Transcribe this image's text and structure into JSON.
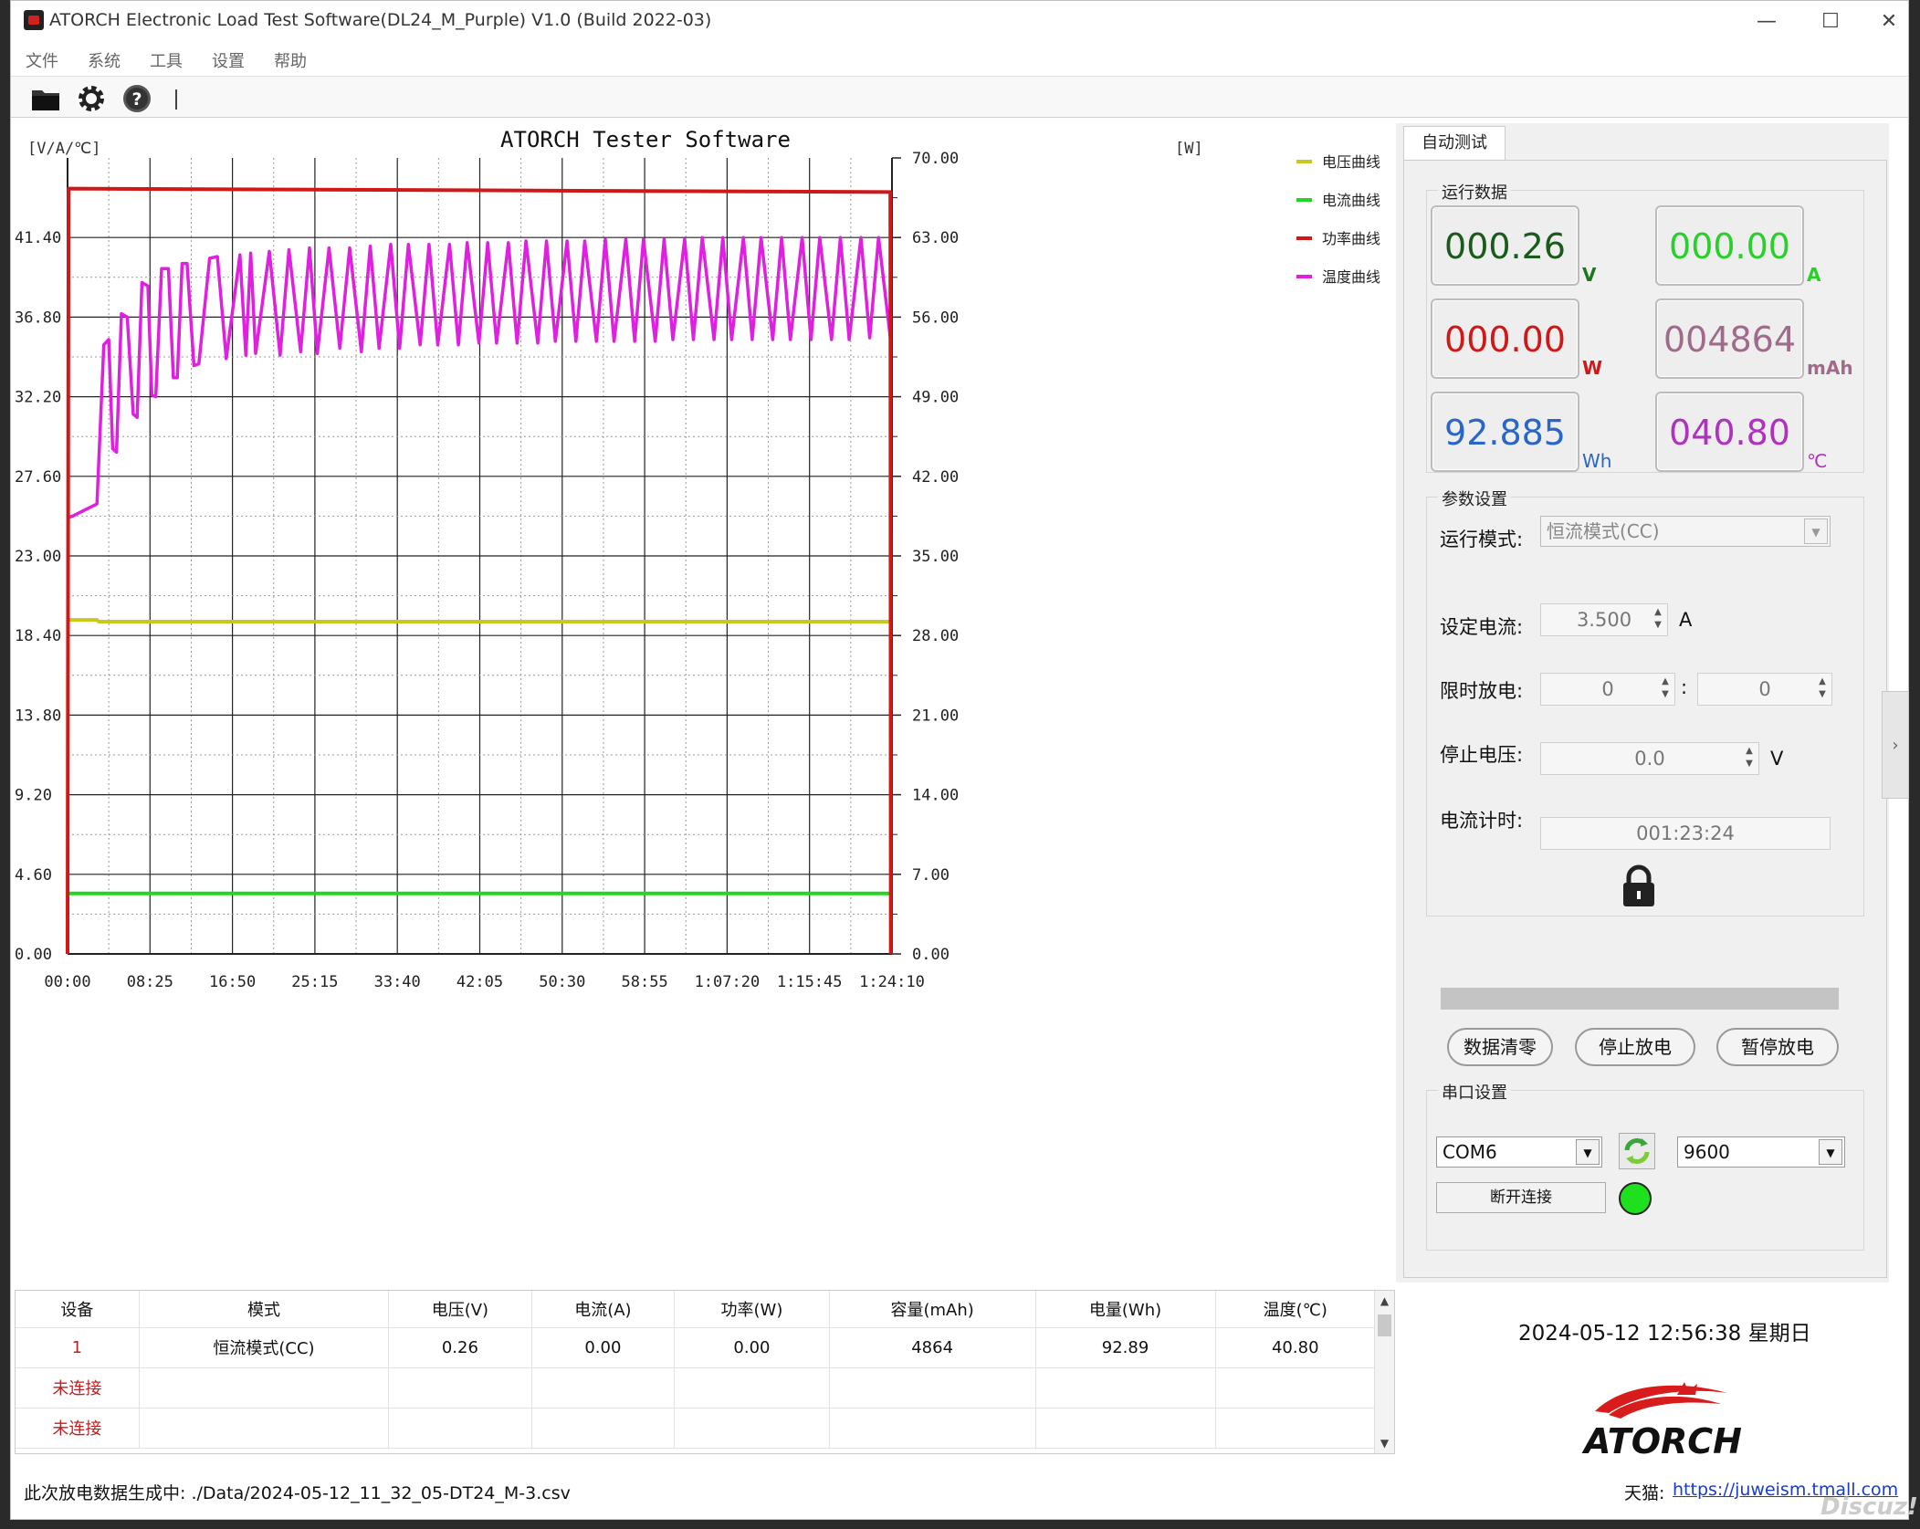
{
  "window": {
    "title": "ATORCH Electronic Load Test Software(DL24_M_Purple) V1.0 (Build 2022-03)",
    "minimize": "—",
    "maximize": "☐",
    "close": "✕"
  },
  "menu": [
    "文件",
    "系统",
    "工具",
    "设置",
    "帮助"
  ],
  "toolbar": {
    "icons": [
      "folder-icon",
      "gear-icon",
      "help-icon"
    ],
    "separator": "|"
  },
  "chart_data": {
    "type": "line",
    "title": "ATORCH Tester Software",
    "left_axis_label": "[V/A/℃]",
    "right_axis_label": "[W]",
    "left_ticks": [
      "41.40",
      "36.80",
      "32.20",
      "27.60",
      "23.00",
      "18.40",
      "13.80",
      "9.20",
      "4.60",
      "0.00"
    ],
    "right_ticks": [
      "70.00",
      "63.00",
      "56.00",
      "49.00",
      "42.00",
      "35.00",
      "28.00",
      "21.00",
      "14.00",
      "7.00",
      "0.00"
    ],
    "x_ticks": [
      "00:00",
      "08:25",
      "16:50",
      "25:15",
      "33:40",
      "42:05",
      "50:30",
      "58:55",
      "1:07:20",
      "1:15:45",
      "1:24:10"
    ],
    "xlim_min": [
      0,
      84.17
    ],
    "left_ylim": [
      0,
      46
    ],
    "right_ylim": [
      0,
      70
    ],
    "grid": true,
    "legend_position": "top-right",
    "series": [
      {
        "name": "电压曲线",
        "color": "#c8c81e",
        "axis": "left",
        "x": [
          0,
          3,
          3.2,
          84
        ],
        "values": [
          19.3,
          19.3,
          19.2,
          19.2
        ]
      },
      {
        "name": "电流曲线",
        "color": "#22d622",
        "axis": "left",
        "x": [
          0,
          84
        ],
        "values": [
          3.5,
          3.5
        ]
      },
      {
        "name": "功率曲线",
        "color": "#d01818",
        "axis": "right",
        "x": [
          0,
          0.1,
          84,
          84.05
        ],
        "values": [
          0,
          67.3,
          67.0,
          0
        ]
      },
      {
        "name": "温度曲线",
        "color": "#e020e0",
        "axis": "left",
        "x": [
          0,
          0.5,
          3.0,
          3.7,
          4.2,
          4.6,
          5.0,
          5.5,
          6.1,
          6.7,
          7.1,
          7.6,
          8.2,
          8.6,
          9.0,
          9.6,
          10.3,
          10.8,
          11.2,
          11.7,
          12.2,
          12.9,
          13.4,
          14.5,
          15.3,
          16.2,
          17.6,
          18.2,
          18.7,
          19.2,
          20.6,
          21.7,
          22.6,
          23.8,
          24.7,
          25.5,
          26.7,
          27.8,
          28.8,
          30.0,
          30.9,
          31.8,
          33.0,
          33.9,
          34.8,
          36.0,
          36.9,
          37.8,
          39.0,
          39.9,
          40.8,
          42.0,
          42.9,
          43.8,
          45.0,
          45.9,
          46.8,
          48.0,
          48.9,
          49.8,
          51.0,
          51.9,
          52.8,
          54.0,
          54.9,
          55.8,
          57.0,
          57.9,
          58.8,
          60.0,
          60.9,
          61.8,
          63.0,
          63.9,
          64.8,
          66.0,
          66.9,
          67.8,
          69.0,
          69.9,
          70.8,
          72.0,
          72.9,
          73.8,
          75.0,
          75.9,
          76.8,
          78.0,
          78.9,
          79.8,
          81.0,
          81.9,
          82.8,
          84.0
        ],
        "values": [
          25.2,
          25.3,
          26.0,
          35.2,
          35.5,
          29.2,
          29.0,
          37.0,
          36.8,
          31.2,
          31.0,
          38.8,
          38.6,
          32.3,
          32.2,
          39.6,
          39.6,
          33.3,
          33.3,
          39.9,
          39.9,
          34.0,
          34.1,
          40.2,
          40.3,
          34.4,
          40.4,
          34.6,
          40.5,
          34.7,
          40.6,
          34.6,
          40.7,
          34.8,
          40.8,
          34.7,
          40.8,
          35.0,
          40.8,
          34.8,
          40.9,
          35.0,
          41.0,
          35.0,
          41.0,
          35.2,
          41.0,
          35.2,
          41.0,
          35.2,
          41.1,
          35.3,
          41.1,
          35.3,
          41.1,
          35.3,
          41.2,
          35.3,
          41.2,
          35.4,
          41.2,
          35.4,
          41.2,
          35.4,
          41.3,
          35.4,
          41.3,
          35.4,
          41.3,
          35.4,
          41.3,
          35.5,
          41.3,
          35.5,
          41.4,
          35.5,
          41.4,
          35.5,
          41.4,
          35.5,
          41.4,
          35.5,
          41.4,
          35.5,
          41.4,
          35.5,
          41.4,
          35.5,
          41.4,
          35.5,
          41.4,
          35.6,
          41.4,
          35.6
        ]
      }
    ]
  },
  "right_panel": {
    "tab_label": "自动测试",
    "run_data_title": "运行数据",
    "readings": [
      {
        "value": "000.26",
        "unit": "V",
        "color": "#1a5a1a",
        "unit_color": "#1a7a1a"
      },
      {
        "value": "000.00",
        "unit": "A",
        "color": "#2ad02a",
        "unit_color": "#2ad02a"
      },
      {
        "value": "000.00",
        "unit": "W",
        "color": "#d01818",
        "unit_color": "#d01818"
      },
      {
        "value": "004864",
        "unit": "mAh",
        "color": "#a06a8a",
        "unit_color": "#a06a8a"
      },
      {
        "value": "92.885",
        "unit": "Wh",
        "color": "#2a66c8",
        "unit_color": "#2a66c8"
      },
      {
        "value": "040.80",
        "unit": "℃",
        "color": "#b030c0",
        "unit_color": "#b030c0"
      }
    ],
    "params_title": "参数设置",
    "mode_label": "运行模式:",
    "mode_value": "恒流模式(CC)",
    "current_label": "设定电流:",
    "current_value": "3.500",
    "current_unit": "A",
    "time_label": "限时放电:",
    "time_h": "0",
    "time_sep": ":",
    "time_m": "0",
    "stopv_label": "停止电压:",
    "stopv_value": "0.0",
    "stopv_unit": "V",
    "timer_label": "电流计时:",
    "timer_value": "001:23:24",
    "buttons": [
      "数据清零",
      "停止放电",
      "暂停放电"
    ],
    "serial_title": "串口设置",
    "port": "COM6",
    "baud": "9600",
    "disconnect_label": "断开连接",
    "status_color": "#1ee01e"
  },
  "table": {
    "headers": [
      "设备",
      "模式",
      "电压(V)",
      "电流(A)",
      "功率(W)",
      "容量(mAh)",
      "电量(Wh)",
      "温度(℃)"
    ],
    "rows": [
      [
        "1",
        "恒流模式(CC)",
        "0.26",
        "0.00",
        "0.00",
        "4864",
        "92.89",
        "40.80"
      ],
      [
        "未连接",
        "",
        "",
        "",
        "",
        "",
        "",
        ""
      ],
      [
        "未连接",
        "",
        "",
        "",
        "",
        "",
        "",
        ""
      ]
    ]
  },
  "datetime": "2024-05-12 12:56:38 星期日",
  "logo_text": "ATORCH",
  "status_bar": {
    "file_text": "此次放电数据生成中: ./Data/2024-05-12_11_32_05-DT24_M-3.csv",
    "shop_label": "天猫:",
    "shop_link": "https://juweism.tmall.com"
  },
  "watermark": "Discuz!"
}
